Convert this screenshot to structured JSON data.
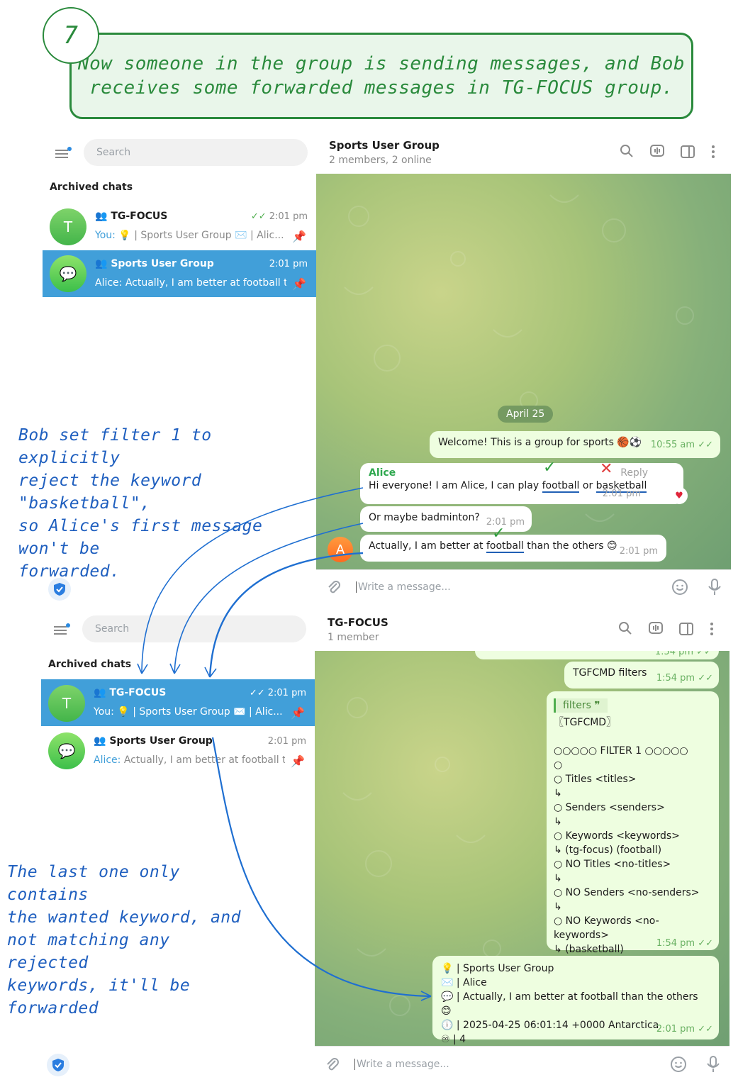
{
  "step": {
    "number": "7",
    "banner_line1": "Now someone in the group is sending messages, and Bob",
    "banner_line2": "receives some forwarded messages in TG-FOCUS group."
  },
  "top": {
    "search_placeholder": "Search",
    "archived": "Archived chats",
    "chats": [
      {
        "avatar": "T",
        "name": "TG-FOCUS",
        "time": "2:01 pm",
        "you": "You:",
        "preview": " | Sports User Group ✉️ | Alic...",
        "ticks": "✓✓"
      },
      {
        "avatar": "💬",
        "name": "Sports User Group",
        "time": "2:01 pm",
        "preview": "Alice: Actually, I am better at football t..."
      }
    ],
    "header_title": "Sports User Group",
    "header_sub": "2 members, 2 online",
    "date_pill": "April 25",
    "msg_welcome": "Welcome! This is a group for sports 🏀⚽",
    "msg_welcome_time": "10:55 am",
    "alice_name": "Alice",
    "reply": "Reply",
    "msg1_a": "Hi everyone! I am Alice, I can play ",
    "msg1_football": "football",
    "msg1_or": " or ",
    "msg1_basketball": "basketball",
    "msg1_time": "2:01 pm",
    "msg2": "Or maybe badminton?",
    "msg2_time": "2:01 pm",
    "msg3_a": "Actually, I am better at ",
    "msg3_football": "football",
    "msg3_b": " than the others 😊",
    "msg3_time": "2:01 pm",
    "avatar_a": "A",
    "composer": "Write a message..."
  },
  "bottom": {
    "search_placeholder": "Search",
    "archived": "Archived chats",
    "chats": [
      {
        "avatar": "T",
        "name": "TG-FOCUS",
        "time": "2:01 pm",
        "you": "You:",
        "preview": " | Sports User Group ✉️ | Alic...",
        "ticks": "✓✓"
      },
      {
        "avatar": "💬",
        "name": "Sports User Group",
        "time": "2:01 pm",
        "alice": "Alice:",
        "preview": " Actually, I am better at football t..."
      }
    ],
    "header_title": "TG-FOCUS",
    "header_sub": "1 member",
    "partial_time": "1:54 pm",
    "cmd": "TGFCMD filters",
    "cmd_time": "1:54 pm",
    "quote_label": "filters",
    "filter_lines": [
      "〖TGFCMD〗",
      "",
      "○○○○○ FILTER 1 ○○○○○",
      "○",
      "○ Titles <titles>",
      "↳",
      "○ Senders <senders>",
      "↳",
      "○ Keywords <keywords>",
      "↳ (tg-focus)  (football)",
      "○ NO Titles <no-titles>",
      "↳",
      "○ NO Senders <no-senders>",
      "↳",
      "○ NO Keywords <no-keywords>",
      "↳ (basketball)"
    ],
    "filter_time": "1:54 pm",
    "fwd_lines": [
      "💡 | Sports User Group",
      "✉️ | Alice",
      "💬 | Actually, I am better at football than the others 😊",
      "🕕 | 2025-04-25 06:01:14 +0000 Antarctica",
      "♾ | 4"
    ],
    "fwd_time": "2:01 pm",
    "composer": "Write a message..."
  },
  "annotations": {
    "left1": [
      "Bob set filter 1 to explicitly",
      "reject the keyword \"basketball\",",
      "so Alice's first message won't be",
      "forwarded."
    ],
    "left2": [
      "The last one only contains",
      "the wanted keyword, and",
      "not matching any rejected",
      "keywords, it'll be forwarded"
    ]
  },
  "colors": {
    "accent_green": "#2a8a3c",
    "selected_blue": "#419fd9",
    "annotation_blue": "#1f5fbf",
    "outgoing_bubble": "#eefee0"
  }
}
